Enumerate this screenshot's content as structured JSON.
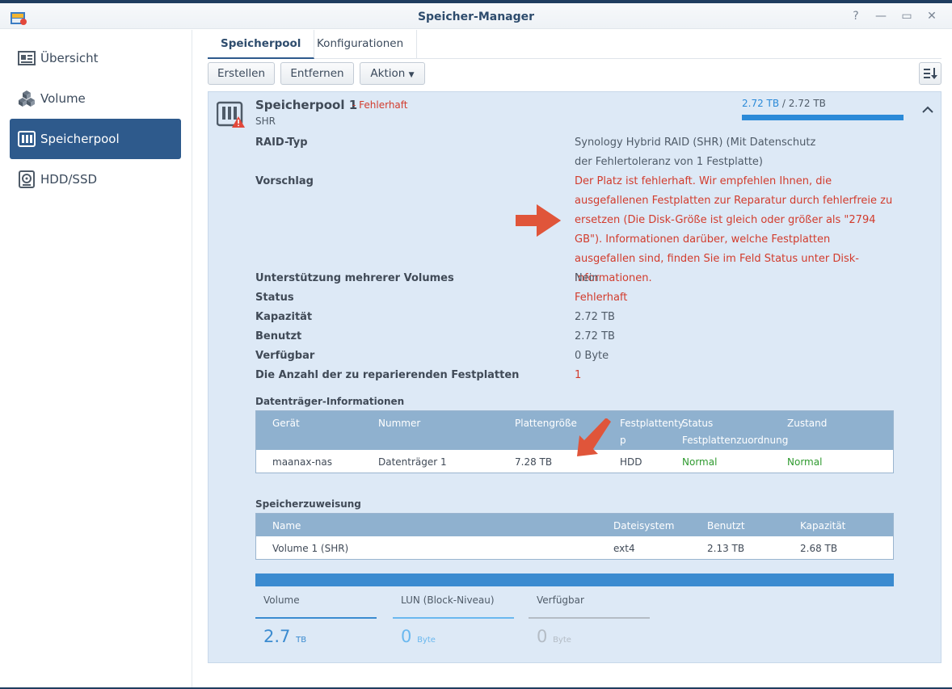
{
  "window": {
    "title": "Speicher-Manager"
  },
  "sidebar": {
    "items": [
      {
        "label": "Übersicht",
        "icon": "overview-icon",
        "active": false
      },
      {
        "label": "Volume",
        "icon": "volume-cubes-icon",
        "active": false
      },
      {
        "label": "Speicherpool",
        "icon": "storage-pool-icon",
        "active": true
      },
      {
        "label": "HDD/SSD",
        "icon": "hdd-icon",
        "active": false
      }
    ]
  },
  "tabs": [
    {
      "label": "Speicherpool",
      "active": true
    },
    {
      "label": "Konfigurationen",
      "active": false
    }
  ],
  "toolbar": {
    "create": "Erstellen",
    "remove": "Entfernen",
    "action": "Aktion"
  },
  "pool": {
    "name": "Speicherpool 1",
    "status": "- Fehlerhaft",
    "type": "SHR",
    "usage_used": "2.72 TB",
    "usage_sep": " / ",
    "usage_total": "2.72 TB",
    "usage_fraction": 1.0,
    "details": {
      "raid_label": "RAID-Typ",
      "raid_value": "Synology Hybrid RAID (SHR) (Mit Datenschutz der Fehlertoleranz von 1 Festplatte)",
      "suggestion_label": "Vorschlag",
      "suggestion_value": "Der Platz ist fehlerhaft. Wir empfehlen Ihnen, die ausgefallenen Festplatten zur Reparatur durch fehlerfreie zu ersetzen (Die Disk-Größe ist gleich oder größer als \"2794 GB\"). Informationen darüber, welche Festplatten ausgefallen sind, finden Sie im Feld Status unter Disk-Informationen.",
      "multi_label": "Unterstützung mehrerer Volumes",
      "multi_value": "Nein",
      "status_label": "Status",
      "status_value": "Fehlerhaft",
      "capacity_label": "Kapazität",
      "capacity_value": "2.72 TB",
      "used_label": "Benutzt",
      "used_value": "2.72 TB",
      "avail_label": "Verfügbar",
      "avail_value": "0 Byte",
      "repair_label": "Die Anzahl der zu reparierenden Festplatten",
      "repair_value": "1"
    },
    "disk_info": {
      "title": "Datenträger-Informationen",
      "headers": {
        "device": "Gerät",
        "number": "Nummer",
        "size": "Plattengröße",
        "type_1": "Festplattenty",
        "type_2": "p",
        "status_1": "Status",
        "status_2": "Festplattenzuordnung",
        "state": "Zustand"
      },
      "rows": [
        {
          "device": "maanax-nas",
          "number": "Datenträger 1",
          "size": "7.28 TB",
          "type": "HDD",
          "status": "Normal",
          "state": "Normal"
        }
      ]
    },
    "allocation": {
      "title": "Speicherzuweisung",
      "headers": {
        "name": "Name",
        "fs": "Dateisystem",
        "used": "Benutzt",
        "capacity": "Kapazität"
      },
      "rows": [
        {
          "name": "Volume 1 (SHR)",
          "fs": "ext4",
          "used": "2.13 TB",
          "capacity": "2.68 TB"
        }
      ]
    },
    "legend": [
      {
        "label": "Volume",
        "value": "2.7",
        "unit": "TB",
        "color": "#3b8bd0"
      },
      {
        "label": "LUN (Block-Niveau)",
        "value": "0",
        "unit": "Byte",
        "color": "#6ab8ef"
      },
      {
        "label": "Verfügbar",
        "value": "0",
        "unit": "Byte",
        "color": "#b4bcc5"
      }
    ]
  },
  "colors": {
    "accent": "#2e5a8c",
    "error": "#d23c2d",
    "ok": "#2f9a2f",
    "arrow": "#e0553a"
  }
}
